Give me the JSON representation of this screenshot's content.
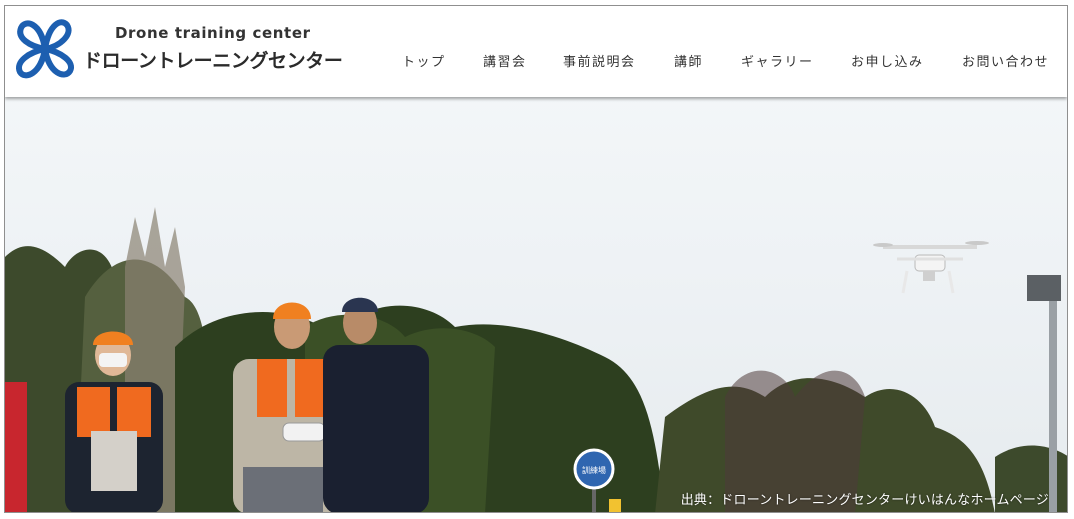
{
  "brand": {
    "title_en": "Drone training center",
    "title_ja": "ドローントレーニングセンター",
    "logo_icon": "propeller-logo-icon",
    "accent_color": "#1d5fb0"
  },
  "nav": {
    "items": [
      {
        "label": "トップ"
      },
      {
        "label": "講習会"
      },
      {
        "label": "事前説明会"
      },
      {
        "label": "講師"
      },
      {
        "label": "ギャラリー"
      },
      {
        "label": "お申し込み"
      },
      {
        "label": "お問い合わせ"
      }
    ]
  },
  "hero": {
    "caption": "出典：ドローントレーニングセンターけいはんなホームページ",
    "sign_text": "訓練場"
  }
}
